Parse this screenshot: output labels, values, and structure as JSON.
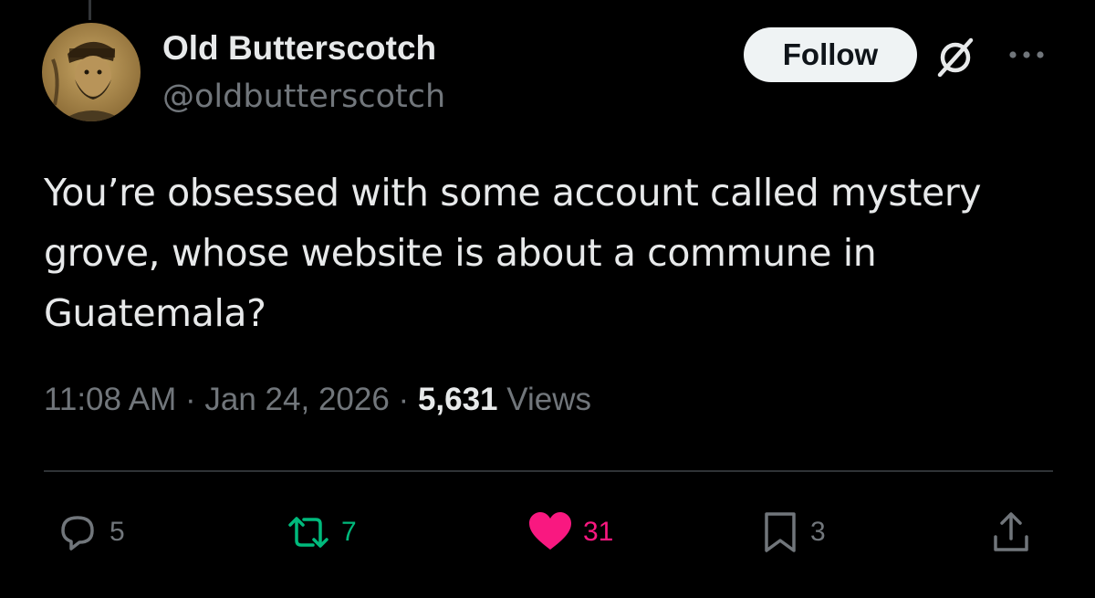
{
  "colors": {
    "background": "#000000",
    "text_primary": "#e7e9ea",
    "text_secondary": "#71767b",
    "retweet_active": "#00ba7c",
    "like_active": "#f91880",
    "follow_button_bg": "#eff3f4"
  },
  "author": {
    "display_name": "Old Butterscotch",
    "handle": "@oldbutterscotch",
    "avatar_icon": "avatar-photo"
  },
  "header": {
    "follow_label": "Follow",
    "grok_icon": "grok-icon",
    "more_icon": "more-icon"
  },
  "tweet": {
    "text": "You’re obsessed with some account called mystery grove, whose website is about a commune in Guatemala?",
    "time": "11:08 AM",
    "separator": "·",
    "date": "Jan 24, 2026",
    "views_count": "5,631",
    "views_label": "Views"
  },
  "actions": {
    "reply": {
      "icon": "reply-icon",
      "count": "5"
    },
    "retweet": {
      "icon": "retweet-icon",
      "count": "7",
      "active": true
    },
    "like": {
      "icon": "heart-icon",
      "count": "31",
      "active": true
    },
    "bookmark": {
      "icon": "bookmark-icon",
      "count": "3"
    },
    "share": {
      "icon": "share-icon"
    }
  }
}
